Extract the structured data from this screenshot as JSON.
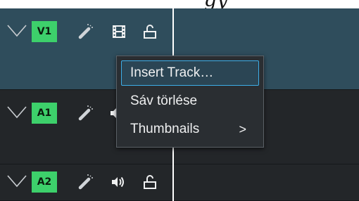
{
  "window": {
    "top_text": "gy",
    "cursor_color": "#ffffff"
  },
  "tracks": [
    {
      "name": "V1",
      "icons": [
        "effects-wand-icon",
        "film-icon",
        "lock-icon"
      ],
      "selected": true,
      "tag_color": "#3dd06b"
    },
    {
      "name": "A1",
      "icons": [
        "effects-wand-icon",
        "speaker-icon"
      ],
      "selected": false,
      "tag_color": "#3dd06b"
    },
    {
      "name": "A2",
      "icons": [
        "effects-wand-icon",
        "speaker-icon",
        "lock-icon"
      ],
      "selected": false,
      "tag_color": "#3dd06b"
    }
  ],
  "context_menu": {
    "items": [
      {
        "label": "Insert Track…",
        "highlighted": true
      },
      {
        "label": "Sáv törlése",
        "highlighted": false
      },
      {
        "label": "Thumbnails",
        "submenu_arrow": ">",
        "highlighted": false
      }
    ],
    "accent_color": "#3daee9"
  }
}
